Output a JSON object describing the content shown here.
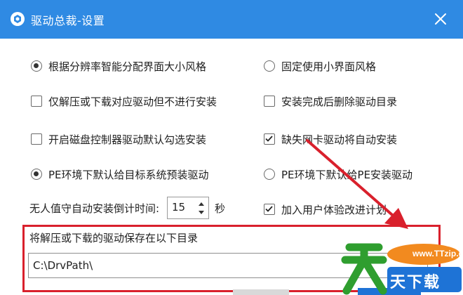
{
  "window": {
    "title": "驱动总裁-设置"
  },
  "options": {
    "resolution_style": {
      "label": "根据分辨率智能分配界面大小风格",
      "selected": true
    },
    "fixed_small_style": {
      "label": "固定使用小界面风格",
      "selected": false
    },
    "extract_only": {
      "label": "仅解压或下载对应驱动但不进行安装",
      "checked": false
    },
    "delete_after_install": {
      "label": "安装完成后删除驱动目录",
      "checked": false
    },
    "disk_controller_default": {
      "label": "开启磁盘控制器驱动默认勾选安装",
      "checked": false
    },
    "auto_install_nic": {
      "label": "缺失网卡驱动将自动安装",
      "checked": true
    },
    "pe_preinstall_target": {
      "label": "PE环境下默认给目标系统预装驱动",
      "selected": true
    },
    "pe_install_to_pe": {
      "label": "PE环境下默认给PE安装驱动",
      "selected": false
    },
    "user_experience": {
      "label": "加入用户体验改进计划",
      "checked": true
    }
  },
  "countdown": {
    "label": "无人值守自动安装倒计时间:",
    "value": "15",
    "unit": "秒"
  },
  "directory": {
    "label": "将解压或下载的驱动保存在以下目录",
    "value": "C:\\DrvPath\\"
  },
  "watermark": {
    "url": "www.TTzip.com",
    "text": "天下载"
  },
  "colors": {
    "titlebar": "#2f8ae3",
    "highlight_box": "#d9202c",
    "arrow": "#d9202c"
  }
}
